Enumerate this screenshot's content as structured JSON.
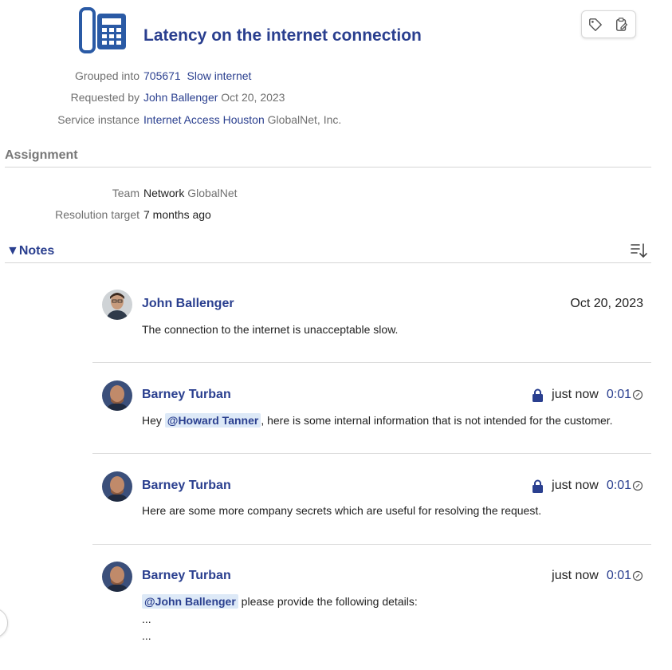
{
  "request": {
    "title": "Latency on the internet connection",
    "icon": "telephone-icon",
    "grouped_into": {
      "label": "Grouped into",
      "id": "705671",
      "name": "Slow internet"
    },
    "requested_by": {
      "label": "Requested by",
      "name": "John Ballenger",
      "date": "Oct 20, 2023"
    },
    "service_instance": {
      "label": "Service instance",
      "name": "Internet Access Houston",
      "provider": "GlobalNet, Inc."
    }
  },
  "actions": {
    "tag_icon": "tag-icon",
    "clipboard_icon": "clipboard-edit-icon"
  },
  "assignment": {
    "heading": "Assignment",
    "team": {
      "label": "Team",
      "value": "Network",
      "org": "GlobalNet"
    },
    "resolution_target": {
      "label": "Resolution target",
      "value": "7 months ago"
    }
  },
  "notes": {
    "heading": "▼Notes",
    "sort_icon": "sort-descending-icon",
    "items": [
      {
        "author": "John Ballenger",
        "time": "Oct 20, 2023",
        "private": false,
        "time_spent": "",
        "text": "The connection to the internet is unacceptable slow."
      },
      {
        "author": "Barney Turban",
        "time": "just now",
        "private": true,
        "time_spent": "0:01",
        "mention": "@Howard Tanner",
        "text_before": "Hey ",
        "text_after": ", here is some internal information that is not intended for the customer."
      },
      {
        "author": "Barney Turban",
        "time": "just now",
        "private": true,
        "time_spent": "0:01",
        "text": "Here are some more company secrets which are useful for resolving the request."
      },
      {
        "author": "Barney Turban",
        "time": "just now",
        "private": false,
        "time_spent": "0:01",
        "mention": "@John Ballenger",
        "text_after": " please provide the following details:",
        "extra_lines": [
          "...",
          "..."
        ]
      }
    ]
  },
  "colors": {
    "accent": "#2a3f8f",
    "mention_bg": "#dde9f7",
    "muted": "#707070"
  }
}
